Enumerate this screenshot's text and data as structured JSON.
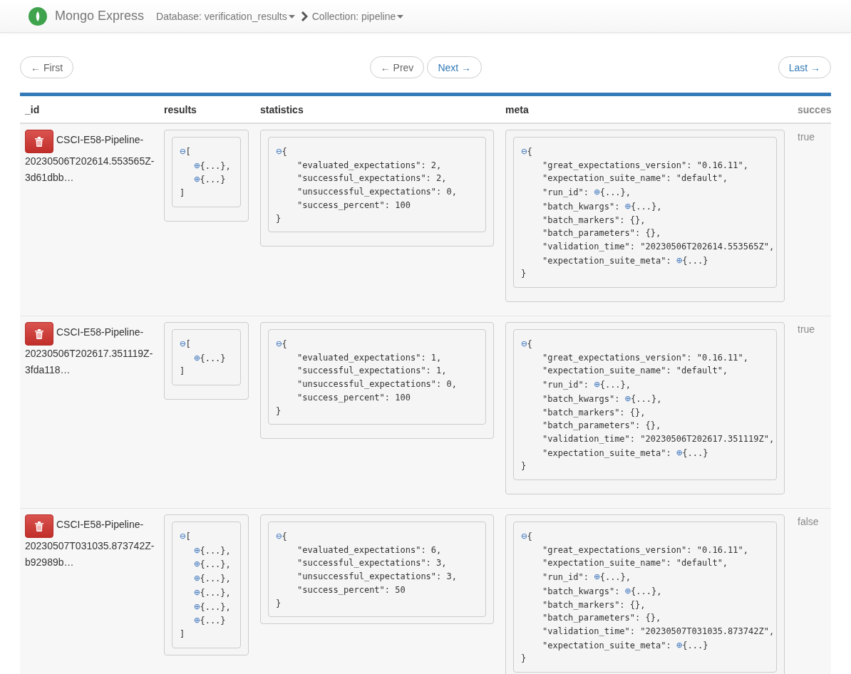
{
  "navbar": {
    "brand": "Mongo Express",
    "breadcrumbs": [
      {
        "label": "Database: verification_results"
      },
      {
        "label": "Collection: pipeline"
      }
    ]
  },
  "pagination": {
    "first": "← First",
    "prev": "← Prev",
    "next": "Next →",
    "last": "Last →"
  },
  "table": {
    "columns": [
      "_id",
      "results",
      "statistics",
      "meta",
      "succes"
    ],
    "rows": [
      {
        "id": "CSCI-E58-Pipeline-20230506T202614.553565Z-3d61dbb…",
        "success": "true",
        "results": [
          {
            "toggle": "⊖",
            "after": "["
          },
          {
            "toggle": "⊕",
            "after": "{...},"
          },
          {
            "toggle": "⊕",
            "after": "{...}"
          },
          {
            "text": "]"
          }
        ],
        "statistics": [
          {
            "toggle": "⊖",
            "after": "{"
          },
          {
            "text": "\"evaluated_expectations\": 2,"
          },
          {
            "text": "\"successful_expectations\": 2,"
          },
          {
            "text": "\"unsuccessful_expectations\": 0,"
          },
          {
            "text": "\"success_percent\": 100"
          },
          {
            "text": "}"
          }
        ],
        "meta": [
          {
            "toggle": "⊖",
            "after": "{"
          },
          {
            "text": "\"great_expectations_version\": \"0.16.11\","
          },
          {
            "text": "\"expectation_suite_name\": \"default\","
          },
          {
            "text": "\"run_id\": ",
            "toggle": "⊕",
            "after": "{...},"
          },
          {
            "text": "\"batch_kwargs\": ",
            "toggle": "⊕",
            "after": "{...},"
          },
          {
            "text": "\"batch_markers\": {},"
          },
          {
            "text": "\"batch_parameters\": {},"
          },
          {
            "text": "\"validation_time\": \"20230506T202614.553565Z\","
          },
          {
            "text": "\"expectation_suite_meta\": ",
            "toggle": "⊕",
            "after": "{...}"
          },
          {
            "text": "}"
          }
        ]
      },
      {
        "id": "CSCI-E58-Pipeline-20230506T202617.351119Z-3fda118…",
        "success": "true",
        "results": [
          {
            "toggle": "⊖",
            "after": "["
          },
          {
            "toggle": "⊕",
            "after": "{...}"
          },
          {
            "text": "]"
          }
        ],
        "statistics": [
          {
            "toggle": "⊖",
            "after": "{"
          },
          {
            "text": "\"evaluated_expectations\": 1,"
          },
          {
            "text": "\"successful_expectations\": 1,"
          },
          {
            "text": "\"unsuccessful_expectations\": 0,"
          },
          {
            "text": "\"success_percent\": 100"
          },
          {
            "text": "}"
          }
        ],
        "meta": [
          {
            "toggle": "⊖",
            "after": "{"
          },
          {
            "text": "\"great_expectations_version\": \"0.16.11\","
          },
          {
            "text": "\"expectation_suite_name\": \"default\","
          },
          {
            "text": "\"run_id\": ",
            "toggle": "⊕",
            "after": "{...},"
          },
          {
            "text": "\"batch_kwargs\": ",
            "toggle": "⊕",
            "after": "{...},"
          },
          {
            "text": "\"batch_markers\": {},"
          },
          {
            "text": "\"batch_parameters\": {},"
          },
          {
            "text": "\"validation_time\": \"20230506T202617.351119Z\","
          },
          {
            "text": "\"expectation_suite_meta\": ",
            "toggle": "⊕",
            "after": "{...}"
          },
          {
            "text": "}"
          }
        ]
      },
      {
        "id": "CSCI-E58-Pipeline-20230507T031035.873742Z-b92989b…",
        "success": "false",
        "results": [
          {
            "toggle": "⊖",
            "after": "["
          },
          {
            "toggle": "⊕",
            "after": "{...},"
          },
          {
            "toggle": "⊕",
            "after": "{...},"
          },
          {
            "toggle": "⊕",
            "after": "{...},"
          },
          {
            "toggle": "⊕",
            "after": "{...},"
          },
          {
            "toggle": "⊕",
            "after": "{...},"
          },
          {
            "toggle": "⊕",
            "after": "{...}"
          },
          {
            "text": "]"
          }
        ],
        "statistics": [
          {
            "toggle": "⊖",
            "after": "{"
          },
          {
            "text": "\"evaluated_expectations\": 6,"
          },
          {
            "text": "\"successful_expectations\": 3,"
          },
          {
            "text": "\"unsuccessful_expectations\": 3,"
          },
          {
            "text": "\"success_percent\": 50"
          },
          {
            "text": "}"
          }
        ],
        "meta": [
          {
            "toggle": "⊖",
            "after": "{"
          },
          {
            "text": "\"great_expectations_version\": \"0.16.11\","
          },
          {
            "text": "\"expectation_suite_name\": \"default\","
          },
          {
            "text": "\"run_id\": ",
            "toggle": "⊕",
            "after": "{...},"
          },
          {
            "text": "\"batch_kwargs\": ",
            "toggle": "⊕",
            "after": "{...},"
          },
          {
            "text": "\"batch_markers\": {},"
          },
          {
            "text": "\"batch_parameters\": {},"
          },
          {
            "text": "\"validation_time\": \"20230507T031035.873742Z\","
          },
          {
            "text": "\"expectation_suite_meta\": ",
            "toggle": "⊕",
            "after": "{...}"
          },
          {
            "text": "}"
          }
        ]
      }
    ]
  }
}
